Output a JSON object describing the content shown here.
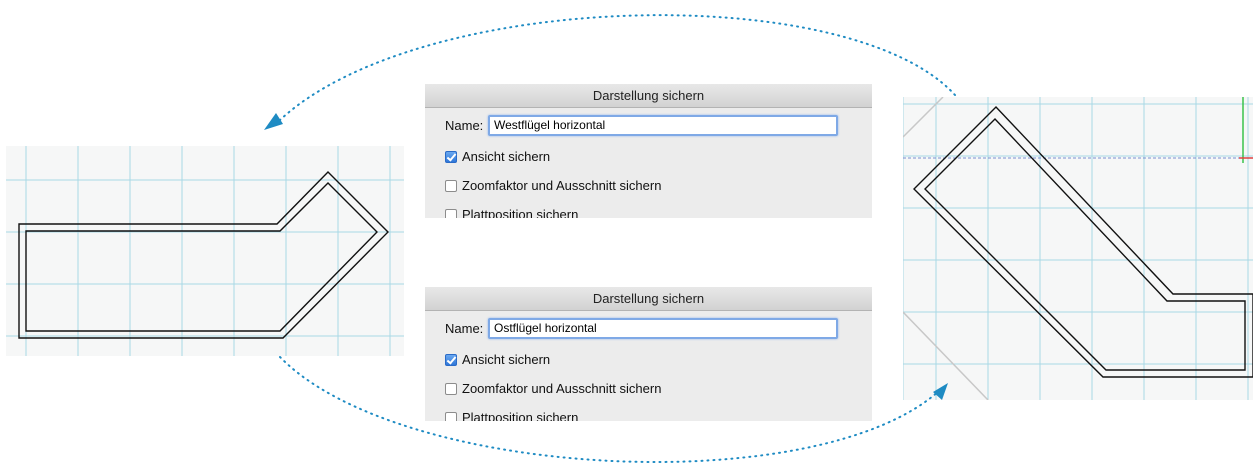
{
  "dialogs": [
    {
      "title": "Darstellung sichern",
      "name_label": "Name:",
      "name_value": "Westflügel horizontal",
      "options": [
        {
          "label": "Ansicht sichern",
          "checked": true
        },
        {
          "label": "Zoomfaktor und Ausschnitt sichern",
          "checked": false
        },
        {
          "label": "Plattposition sichern",
          "checked": false
        }
      ]
    },
    {
      "title": "Darstellung sichern",
      "name_label": "Name:",
      "name_value": "Ostflügel horizontal",
      "options": [
        {
          "label": "Ansicht sichern",
          "checked": true
        },
        {
          "label": "Zoomfaktor und Ausschnitt sichern",
          "checked": false
        },
        {
          "label": "Plattposition sichern",
          "checked": false
        }
      ]
    }
  ],
  "colors": {
    "grid_line": "#a8d8e6",
    "wall_line": "#111111",
    "arrow": "#1e8bc3",
    "axis_green": "#3ac24a",
    "axis_red": "#e04040",
    "dashed_axis": "#7a8fd0"
  }
}
